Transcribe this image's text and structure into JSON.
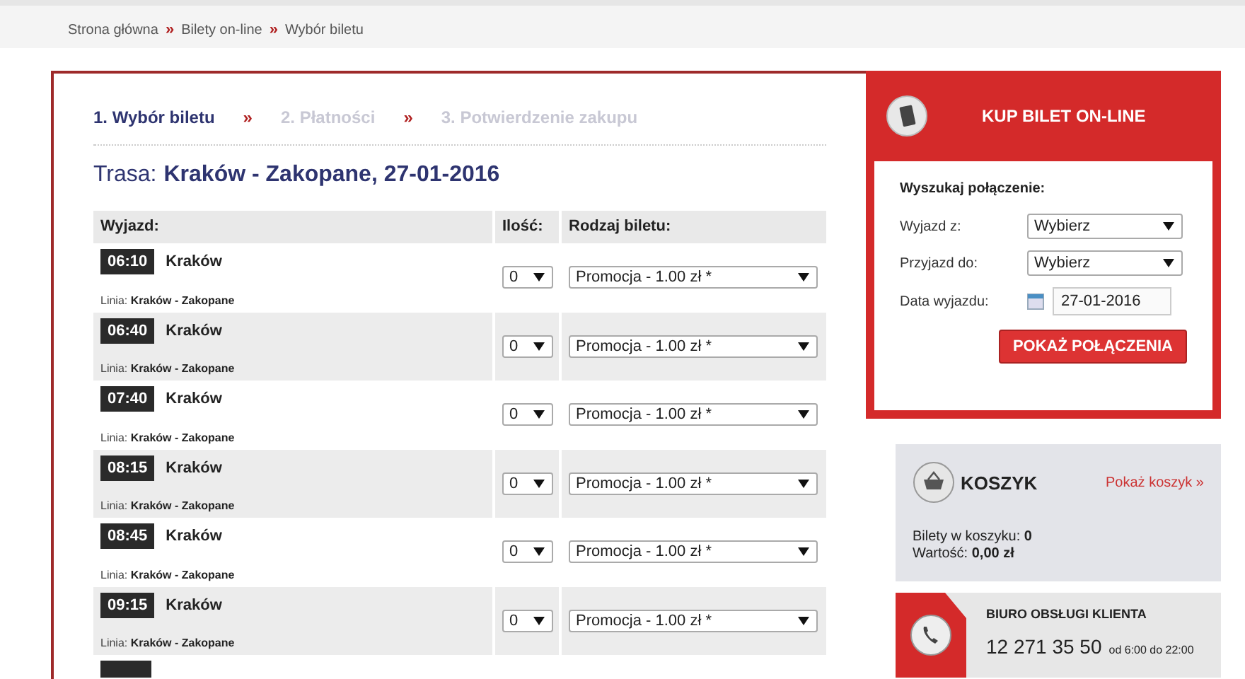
{
  "breadcrumb": {
    "separator": "»",
    "items": [
      {
        "label": "Strona główna"
      },
      {
        "label": "Bilety on-line"
      },
      {
        "label": "Wybór biletu"
      }
    ]
  },
  "steps": {
    "separator": "»",
    "items": [
      {
        "label": "1. Wybór biletu",
        "selected": true
      },
      {
        "label": "2. Płatności",
        "selected": false
      },
      {
        "label": "3. Potwierdzenie zakupu",
        "selected": false
      }
    ]
  },
  "route": {
    "label": "Trasa:",
    "value": "Kraków - Zakopane, 27-01-2016"
  },
  "table": {
    "columns": [
      "Wyjazd:",
      "Ilość:",
      "Rodzaj biletu:"
    ],
    "rows": [
      {
        "time": "06:10",
        "stop": "Kraków",
        "line": "Linia: **Kraków - Zakopane**",
        "quantity": "0",
        "ticket": "Promocja - 1.00 zł *"
      },
      {
        "time": "06:40",
        "stop": "Kraków",
        "line": "Linia: **Kraków - Zakopane**",
        "quantity": "0",
        "ticket": "Promocja - 1.00 zł *"
      },
      {
        "time": "07:40",
        "stop": "Kraków",
        "line": "Linia: **Kraków - Zakopane**",
        "quantity": "0",
        "ticket": "Promocja - 1.00 zł *"
      },
      {
        "time": "08:15",
        "stop": "Kraków",
        "line": "Linia: **Kraków - Zakopane**",
        "quantity": "0",
        "ticket": "Promocja - 1.00 zł *"
      },
      {
        "time": "08:45",
        "stop": "Kraków",
        "line": "Linia: **Kraków - Zakopane**",
        "quantity": "0",
        "ticket": "Promocja - 1.00 zł *"
      },
      {
        "time": "09:15",
        "stop": "Kraków",
        "line": "Linia: **Kraków - Zakopane**",
        "quantity": "0",
        "ticket": "Promocja - 1.00 zł *"
      }
    ]
  },
  "buy": {
    "title": "KUP BILET ON-LINE",
    "heading": "Wyszukaj połączenie:",
    "fields": [
      {
        "label": "Wyjazd z:",
        "kind": "select",
        "value": "Wybierz"
      },
      {
        "label": "Przyjazd do:",
        "kind": "select",
        "value": "Wybierz"
      },
      {
        "label": "Data wyjazdu:",
        "kind": "date",
        "value": "27-01-2016"
      }
    ],
    "button": "POKAŻ POŁĄCZENIA"
  },
  "cart": {
    "title": "KOSZYK",
    "link": "Pokaż koszyk »",
    "lines": [
      "Bilety w koszyku: **0**",
      "Wartość: **0,00 zł**"
    ]
  },
  "service": {
    "title": "BIURO OBSŁUGI KLIENTA",
    "phone": "12 271 35 50",
    "hours": "od 6:00 do 22:00"
  }
}
